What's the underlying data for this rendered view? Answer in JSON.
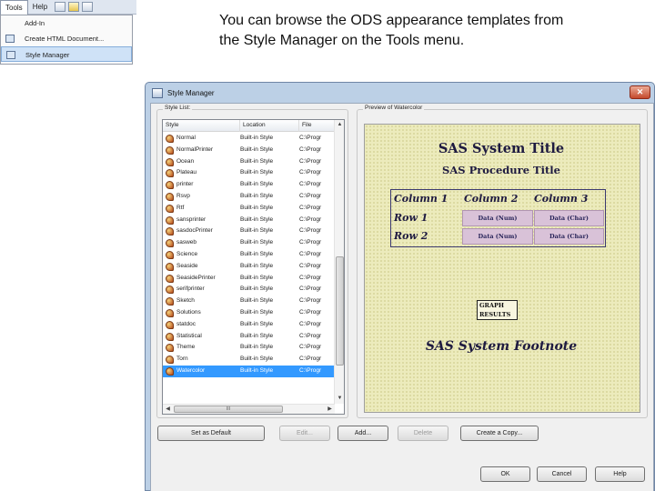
{
  "menu": {
    "bar_items": [
      "Tools",
      "Help"
    ],
    "dropdown_items": [
      "Add-In",
      "Create HTML Document...",
      "Style Manager"
    ]
  },
  "caption": "You can browse the ODS appearance templates from the Style Manager on the Tools menu.",
  "window": {
    "title": "Style Manager",
    "close_glyph": "✕",
    "style_list_label": "Style List:",
    "preview_label": "Preview of Watercolor",
    "columns": [
      "Style",
      "Location",
      "File"
    ],
    "rows": [
      {
        "name": "Normal",
        "location": "Built-in Style",
        "file": "C:\\Progr"
      },
      {
        "name": "NormalPrinter",
        "location": "Built-in Style",
        "file": "C:\\Progr"
      },
      {
        "name": "Ocean",
        "location": "Built-in Style",
        "file": "C:\\Progr"
      },
      {
        "name": "Plateau",
        "location": "Built-in Style",
        "file": "C:\\Progr"
      },
      {
        "name": "printer",
        "location": "Built-in Style",
        "file": "C:\\Progr"
      },
      {
        "name": "Rsvp",
        "location": "Built-in Style",
        "file": "C:\\Progr"
      },
      {
        "name": "Rtf",
        "location": "Built-in Style",
        "file": "C:\\Progr"
      },
      {
        "name": "sansprinter",
        "location": "Built-in Style",
        "file": "C:\\Progr"
      },
      {
        "name": "sasdocPrinter",
        "location": "Built-in Style",
        "file": "C:\\Progr"
      },
      {
        "name": "sasweb",
        "location": "Built-in Style",
        "file": "C:\\Progr"
      },
      {
        "name": "Science",
        "location": "Built-in Style",
        "file": "C:\\Progr"
      },
      {
        "name": "Seaside",
        "location": "Built-in Style",
        "file": "C:\\Progr"
      },
      {
        "name": "SeasidePrinter",
        "location": "Built-in Style",
        "file": "C:\\Progr"
      },
      {
        "name": "serifprinter",
        "location": "Built-in Style",
        "file": "C:\\Progr"
      },
      {
        "name": "Sketch",
        "location": "Built-in Style",
        "file": "C:\\Progr"
      },
      {
        "name": "Solutions",
        "location": "Built-in Style",
        "file": "C:\\Progr"
      },
      {
        "name": "statdoc",
        "location": "Built-in Style",
        "file": "C:\\Progr"
      },
      {
        "name": "Statistical",
        "location": "Built-in Style",
        "file": "C:\\Progr"
      },
      {
        "name": "Theme",
        "location": "Built-in Style",
        "file": "C:\\Progr"
      },
      {
        "name": "Torn",
        "location": "Built-in Style",
        "file": "C:\\Progr"
      },
      {
        "name": "Watercolor",
        "location": "Built-in Style",
        "file": "C:\\Progr"
      }
    ],
    "selected_style": "Watercolor",
    "hscroll_grip": "III",
    "preview": {
      "title": "SAS System Title",
      "subtitle": "SAS Procedure Title",
      "col1": "Column 1",
      "col2": "Column 2",
      "col3": "Column 3",
      "row1": "Row 1",
      "row2": "Row 2",
      "num": "Data (Num)",
      "char": "Data (Char)",
      "graph_line1": "GRAPH",
      "graph_line2": "RESULTS",
      "footnote": "SAS System Footnote"
    },
    "buttons": {
      "set_default": "Set as Default",
      "edit": "Edit...",
      "add": "Add...",
      "delete": "Delete",
      "create_copy": "Create a Copy...",
      "ok": "OK",
      "cancel": "Cancel",
      "help": "Help"
    }
  }
}
